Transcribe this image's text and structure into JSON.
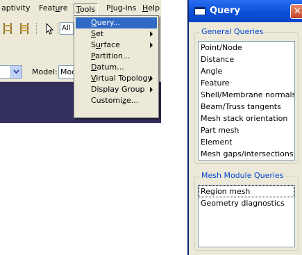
{
  "app": {
    "menubar": {
      "items": [
        {
          "label": "aptivity",
          "accel": ""
        },
        {
          "label": "Feature",
          "pre": "Feat",
          "accel": "u",
          "post": "re"
        },
        {
          "label": "Tools",
          "pre": "",
          "accel": "T",
          "post": "ools"
        },
        {
          "label": "Plug-ins",
          "pre": "P",
          "accel": "l",
          "post": "ug-ins"
        },
        {
          "label": "Help",
          "pre": "",
          "accel": "H",
          "post": "elp"
        }
      ]
    },
    "toolbar": {
      "combo_value": "All"
    },
    "modelbar": {
      "model_label": "Model:",
      "model_value": "Mode"
    },
    "tools_menu": {
      "items": [
        {
          "pre": "",
          "accel": "Q",
          "post": "uery...",
          "submenu": false,
          "selected": true
        },
        {
          "pre": "",
          "accel": "S",
          "post": "et",
          "submenu": true,
          "selected": false
        },
        {
          "pre": "S",
          "accel": "u",
          "post": "rface",
          "submenu": true,
          "selected": false
        },
        {
          "pre": "",
          "accel": "P",
          "post": "artition...",
          "submenu": false,
          "selected": false
        },
        {
          "pre": "",
          "accel": "D",
          "post": "atum...",
          "submenu": false,
          "selected": false
        },
        {
          "pre": "",
          "accel": "V",
          "post": "irtual Topology",
          "submenu": true,
          "selected": false
        },
        {
          "pre": "Display Group",
          "accel": "",
          "post": "",
          "submenu": true,
          "selected": false
        },
        {
          "pre": "Customi",
          "accel": "z",
          "post": "e...",
          "submenu": false,
          "selected": false
        }
      ]
    }
  },
  "dialog": {
    "title": "Query",
    "general": {
      "title": "General Queries",
      "items": [
        "Point/Node",
        "Distance",
        "Angle",
        "Feature",
        "Shell/Membrane normals",
        "Beam/Truss tangents",
        "Mesh stack orientation",
        "Part mesh",
        "Element",
        "Mesh gaps/intersections"
      ]
    },
    "mesh": {
      "title": "Mesh Module Queries",
      "items": [
        "Region mesh",
        "Geometry diagnostics"
      ],
      "selected_index": 0
    }
  }
}
